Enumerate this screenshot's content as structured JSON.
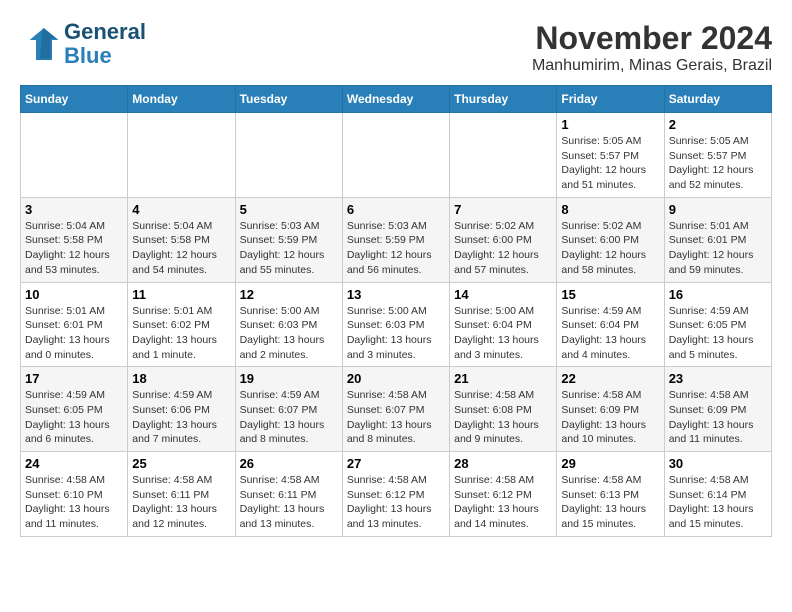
{
  "header": {
    "logo_line1": "General",
    "logo_line2": "Blue",
    "month": "November 2024",
    "location": "Manhumirim, Minas Gerais, Brazil"
  },
  "weekdays": [
    "Sunday",
    "Monday",
    "Tuesday",
    "Wednesday",
    "Thursday",
    "Friday",
    "Saturday"
  ],
  "weeks": [
    [
      {
        "day": "",
        "sunrise": "",
        "sunset": "",
        "daylight": ""
      },
      {
        "day": "",
        "sunrise": "",
        "sunset": "",
        "daylight": ""
      },
      {
        "day": "",
        "sunrise": "",
        "sunset": "",
        "daylight": ""
      },
      {
        "day": "",
        "sunrise": "",
        "sunset": "",
        "daylight": ""
      },
      {
        "day": "",
        "sunrise": "",
        "sunset": "",
        "daylight": ""
      },
      {
        "day": "1",
        "sunrise": "Sunrise: 5:05 AM",
        "sunset": "Sunset: 5:57 PM",
        "daylight": "Daylight: 12 hours and 51 minutes."
      },
      {
        "day": "2",
        "sunrise": "Sunrise: 5:05 AM",
        "sunset": "Sunset: 5:57 PM",
        "daylight": "Daylight: 12 hours and 52 minutes."
      }
    ],
    [
      {
        "day": "3",
        "sunrise": "Sunrise: 5:04 AM",
        "sunset": "Sunset: 5:58 PM",
        "daylight": "Daylight: 12 hours and 53 minutes."
      },
      {
        "day": "4",
        "sunrise": "Sunrise: 5:04 AM",
        "sunset": "Sunset: 5:58 PM",
        "daylight": "Daylight: 12 hours and 54 minutes."
      },
      {
        "day": "5",
        "sunrise": "Sunrise: 5:03 AM",
        "sunset": "Sunset: 5:59 PM",
        "daylight": "Daylight: 12 hours and 55 minutes."
      },
      {
        "day": "6",
        "sunrise": "Sunrise: 5:03 AM",
        "sunset": "Sunset: 5:59 PM",
        "daylight": "Daylight: 12 hours and 56 minutes."
      },
      {
        "day": "7",
        "sunrise": "Sunrise: 5:02 AM",
        "sunset": "Sunset: 6:00 PM",
        "daylight": "Daylight: 12 hours and 57 minutes."
      },
      {
        "day": "8",
        "sunrise": "Sunrise: 5:02 AM",
        "sunset": "Sunset: 6:00 PM",
        "daylight": "Daylight: 12 hours and 58 minutes."
      },
      {
        "day": "9",
        "sunrise": "Sunrise: 5:01 AM",
        "sunset": "Sunset: 6:01 PM",
        "daylight": "Daylight: 12 hours and 59 minutes."
      }
    ],
    [
      {
        "day": "10",
        "sunrise": "Sunrise: 5:01 AM",
        "sunset": "Sunset: 6:01 PM",
        "daylight": "Daylight: 13 hours and 0 minutes."
      },
      {
        "day": "11",
        "sunrise": "Sunrise: 5:01 AM",
        "sunset": "Sunset: 6:02 PM",
        "daylight": "Daylight: 13 hours and 1 minute."
      },
      {
        "day": "12",
        "sunrise": "Sunrise: 5:00 AM",
        "sunset": "Sunset: 6:03 PM",
        "daylight": "Daylight: 13 hours and 2 minutes."
      },
      {
        "day": "13",
        "sunrise": "Sunrise: 5:00 AM",
        "sunset": "Sunset: 6:03 PM",
        "daylight": "Daylight: 13 hours and 3 minutes."
      },
      {
        "day": "14",
        "sunrise": "Sunrise: 5:00 AM",
        "sunset": "Sunset: 6:04 PM",
        "daylight": "Daylight: 13 hours and 3 minutes."
      },
      {
        "day": "15",
        "sunrise": "Sunrise: 4:59 AM",
        "sunset": "Sunset: 6:04 PM",
        "daylight": "Daylight: 13 hours and 4 minutes."
      },
      {
        "day": "16",
        "sunrise": "Sunrise: 4:59 AM",
        "sunset": "Sunset: 6:05 PM",
        "daylight": "Daylight: 13 hours and 5 minutes."
      }
    ],
    [
      {
        "day": "17",
        "sunrise": "Sunrise: 4:59 AM",
        "sunset": "Sunset: 6:05 PM",
        "daylight": "Daylight: 13 hours and 6 minutes."
      },
      {
        "day": "18",
        "sunrise": "Sunrise: 4:59 AM",
        "sunset": "Sunset: 6:06 PM",
        "daylight": "Daylight: 13 hours and 7 minutes."
      },
      {
        "day": "19",
        "sunrise": "Sunrise: 4:59 AM",
        "sunset": "Sunset: 6:07 PM",
        "daylight": "Daylight: 13 hours and 8 minutes."
      },
      {
        "day": "20",
        "sunrise": "Sunrise: 4:58 AM",
        "sunset": "Sunset: 6:07 PM",
        "daylight": "Daylight: 13 hours and 8 minutes."
      },
      {
        "day": "21",
        "sunrise": "Sunrise: 4:58 AM",
        "sunset": "Sunset: 6:08 PM",
        "daylight": "Daylight: 13 hours and 9 minutes."
      },
      {
        "day": "22",
        "sunrise": "Sunrise: 4:58 AM",
        "sunset": "Sunset: 6:09 PM",
        "daylight": "Daylight: 13 hours and 10 minutes."
      },
      {
        "day": "23",
        "sunrise": "Sunrise: 4:58 AM",
        "sunset": "Sunset: 6:09 PM",
        "daylight": "Daylight: 13 hours and 11 minutes."
      }
    ],
    [
      {
        "day": "24",
        "sunrise": "Sunrise: 4:58 AM",
        "sunset": "Sunset: 6:10 PM",
        "daylight": "Daylight: 13 hours and 11 minutes."
      },
      {
        "day": "25",
        "sunrise": "Sunrise: 4:58 AM",
        "sunset": "Sunset: 6:11 PM",
        "daylight": "Daylight: 13 hours and 12 minutes."
      },
      {
        "day": "26",
        "sunrise": "Sunrise: 4:58 AM",
        "sunset": "Sunset: 6:11 PM",
        "daylight": "Daylight: 13 hours and 13 minutes."
      },
      {
        "day": "27",
        "sunrise": "Sunrise: 4:58 AM",
        "sunset": "Sunset: 6:12 PM",
        "daylight": "Daylight: 13 hours and 13 minutes."
      },
      {
        "day": "28",
        "sunrise": "Sunrise: 4:58 AM",
        "sunset": "Sunset: 6:12 PM",
        "daylight": "Daylight: 13 hours and 14 minutes."
      },
      {
        "day": "29",
        "sunrise": "Sunrise: 4:58 AM",
        "sunset": "Sunset: 6:13 PM",
        "daylight": "Daylight: 13 hours and 15 minutes."
      },
      {
        "day": "30",
        "sunrise": "Sunrise: 4:58 AM",
        "sunset": "Sunset: 6:14 PM",
        "daylight": "Daylight: 13 hours and 15 minutes."
      }
    ]
  ]
}
